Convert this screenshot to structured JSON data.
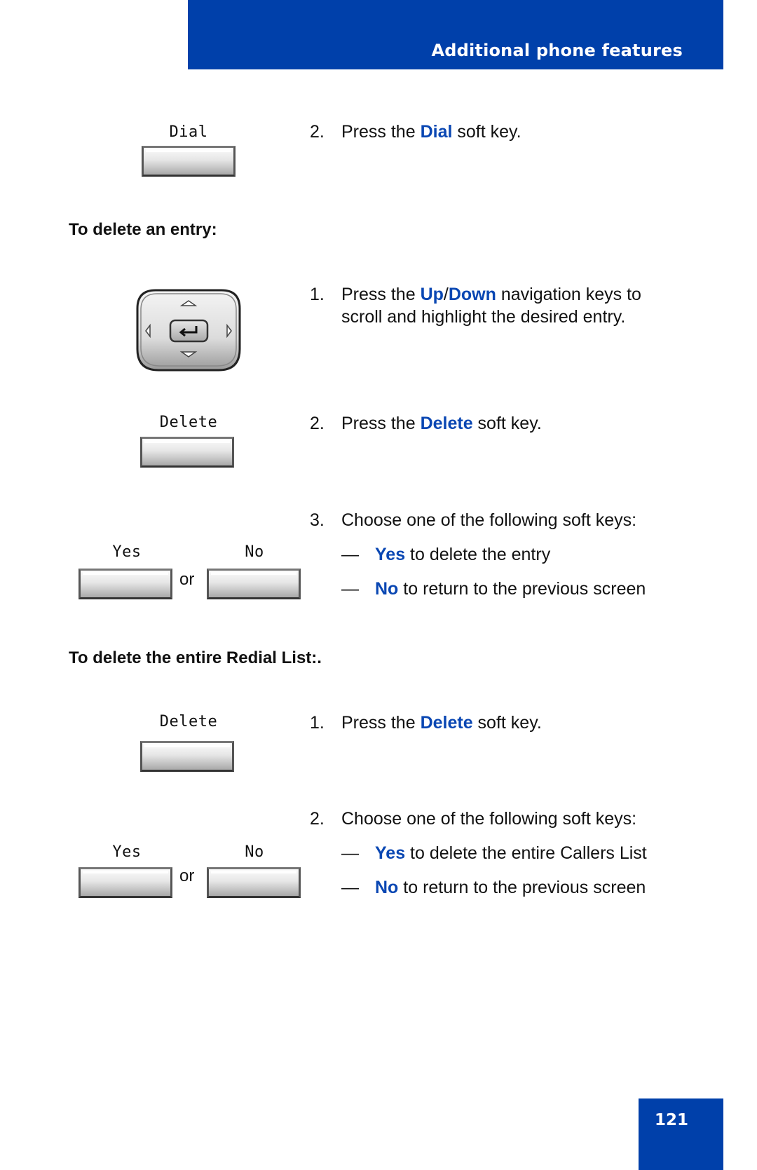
{
  "header": {
    "title": "Additional phone features",
    "accent_color": "#0040AA"
  },
  "page_number": "121",
  "section_top": {
    "softkey_label": "Dial",
    "step": {
      "number": "2.",
      "pre": "Press the ",
      "keyword": "Dial",
      "post": " soft key."
    }
  },
  "section_delete_entry": {
    "heading": "To delete an entry:",
    "navkey_icon": "navigation-cluster-icon",
    "step1": {
      "number": "1.",
      "pre": "Press the ",
      "keyword1": "Up",
      "sep": "/",
      "keyword2": "Down",
      "post": " navigation keys to",
      "line2": "scroll and highlight the desired entry."
    },
    "step2": {
      "softkey_label": "Delete",
      "number": "2.",
      "pre": "Press the ",
      "keyword": "Delete",
      "post": " soft key."
    },
    "step3": {
      "yes_label": "Yes",
      "no_label": "No",
      "or": "or",
      "number": "3.",
      "text": "Choose one of the following soft keys:",
      "options": [
        {
          "dash": "—",
          "keyword": "Yes",
          "text": " to delete the entry"
        },
        {
          "dash": "—",
          "keyword": "No",
          "text": " to return to the previous screen"
        }
      ]
    }
  },
  "section_delete_list": {
    "heading": "To delete the entire Redial List:.",
    "step1": {
      "softkey_label": "Delete",
      "number": "1.",
      "pre": "Press the ",
      "keyword": "Delete",
      "post": " soft key."
    },
    "step2": {
      "yes_label": "Yes",
      "no_label": "No",
      "or": "or",
      "number": "2.",
      "text": "Choose one of the following soft keys:",
      "options": [
        {
          "dash": "—",
          "keyword": "Yes",
          "text": " to delete the entire Callers List"
        },
        {
          "dash": "—",
          "keyword": "No",
          "text": " to return to the previous screen"
        }
      ]
    }
  }
}
